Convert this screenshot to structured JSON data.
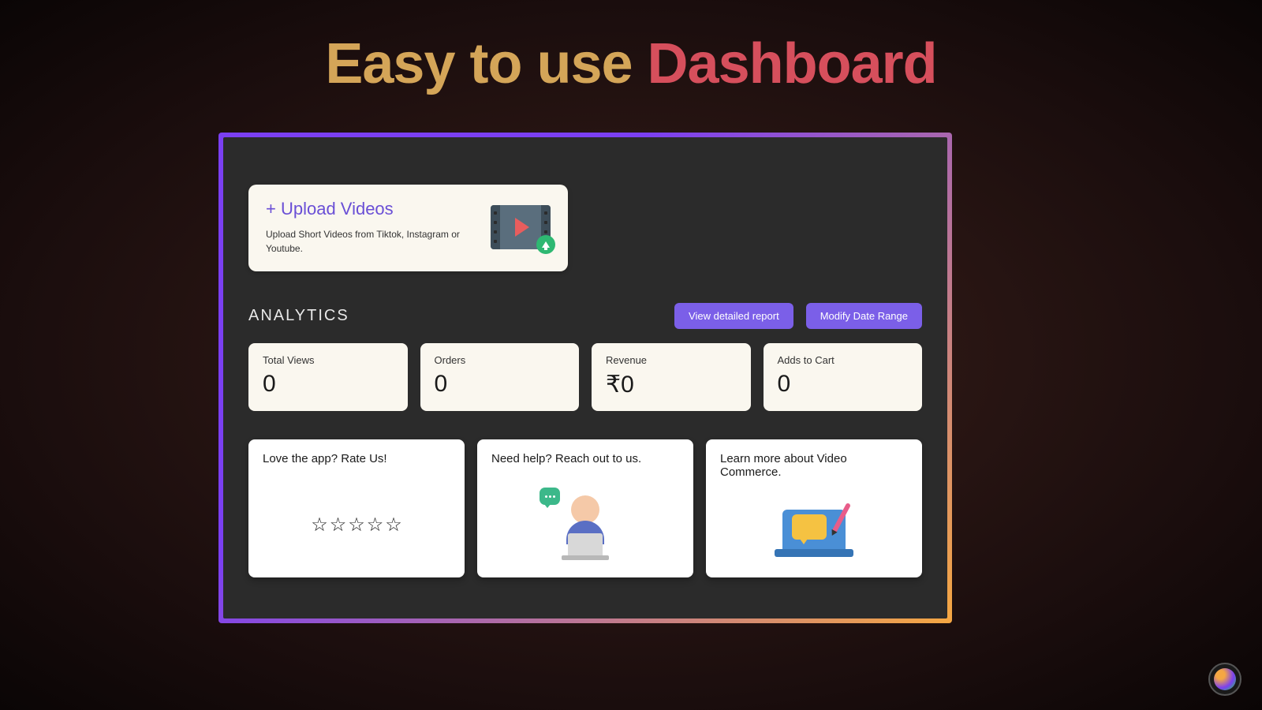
{
  "headline": {
    "part1": "Easy to use ",
    "part2": "Dashboard"
  },
  "upload": {
    "title": "+ Upload Videos",
    "description": "Upload Short Videos from Tiktok, Instagram or Youtube."
  },
  "analytics": {
    "title": "ANALYTICS",
    "buttons": {
      "detailed": "View detailed report",
      "modify": "Modify Date Range"
    },
    "stats": [
      {
        "label": "Total Views",
        "value": "0"
      },
      {
        "label": "Orders",
        "value": "0"
      },
      {
        "label": "Revenue",
        "value": "₹0"
      },
      {
        "label": "Adds to Cart",
        "value": "0"
      }
    ]
  },
  "info_cards": {
    "rate": "Love the app? Rate Us!",
    "help": "Need help? Reach out to us.",
    "learn": "Learn more about Video Commerce."
  }
}
